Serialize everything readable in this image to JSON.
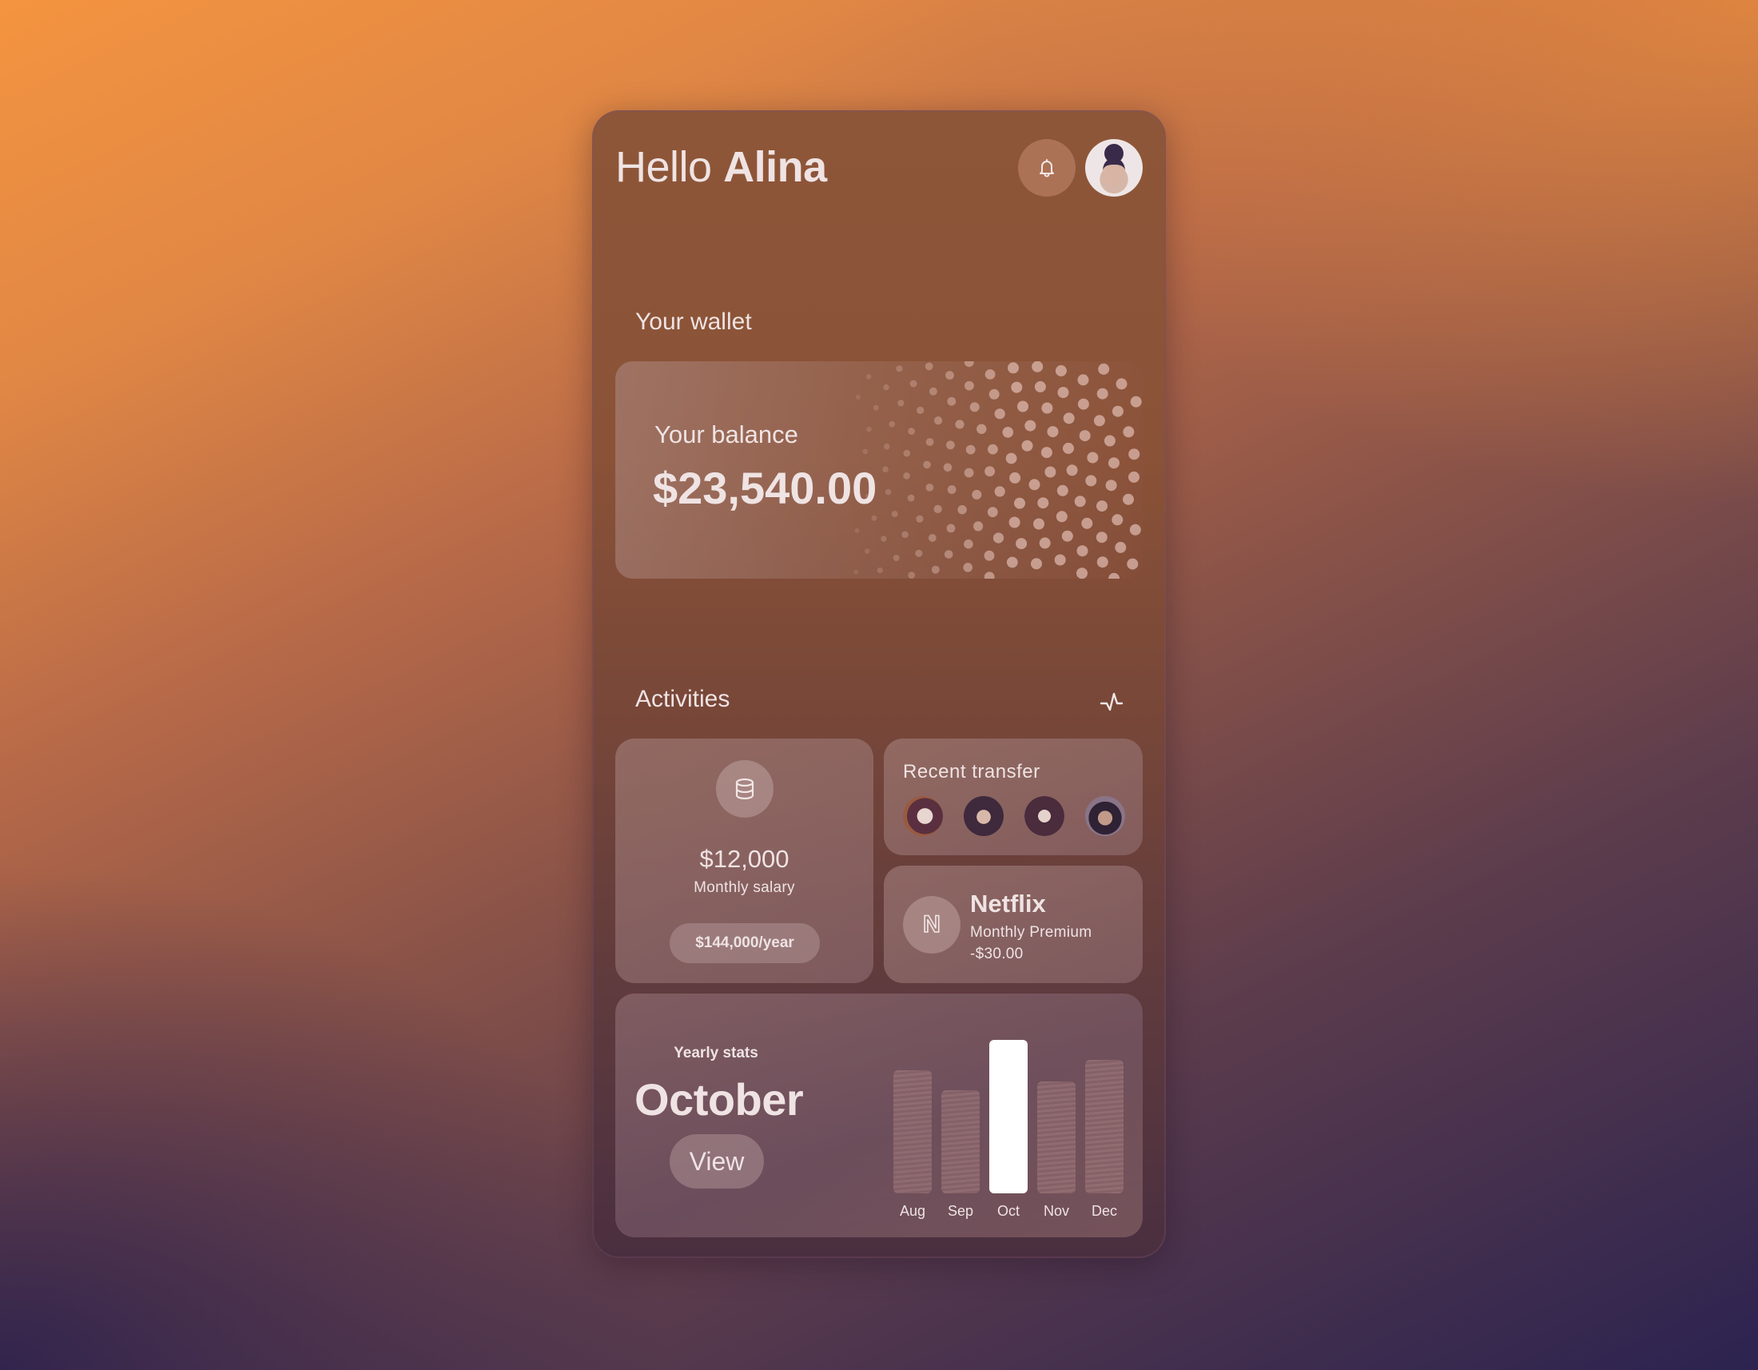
{
  "header": {
    "greeting_prefix": "Hello",
    "user_name": "Alina",
    "notification_icon": "bell-icon",
    "avatar_alt": "Alina profile photo"
  },
  "wallet": {
    "section_title": "Your wallet",
    "balance_label": "Your balance",
    "balance_value": "$23,540.00"
  },
  "activities": {
    "section_title": "Activities",
    "header_icon": "activity-pulse-icon",
    "salary": {
      "icon": "database-coins-icon",
      "amount": "$12,000",
      "label": "Monthly salary",
      "yearly_pill": "$144,000/year"
    },
    "recent_transfer": {
      "title": "Recent transfer",
      "contacts": [
        {
          "name": "contact-1"
        },
        {
          "name": "contact-2"
        },
        {
          "name": "contact-3"
        },
        {
          "name": "contact-4"
        }
      ]
    },
    "subscription": {
      "logo_letter": "N",
      "name": "Netflix",
      "plan": "Monthly Premium",
      "amount": "-$30.00"
    }
  },
  "stats": {
    "label": "Yearly stats",
    "month": "October",
    "view_button": "View"
  },
  "chart_data": {
    "type": "bar",
    "title": "Yearly stats",
    "categories": [
      "Aug",
      "Sep",
      "Oct",
      "Nov",
      "Dec"
    ],
    "values": [
      80,
      67,
      100,
      73,
      87
    ],
    "value_units": "relative (Oct = 100, no axis shown)",
    "highlighted": "Oct",
    "xlabel": "",
    "ylabel": "",
    "ylim": [
      0,
      100
    ],
    "grid": false,
    "legend": "none"
  },
  "colors": {
    "text": "#efe3e3",
    "highlight_bar": "#ffffff",
    "background_top_right": "#f08c3c",
    "background_bottom_left": "#2a2148"
  }
}
